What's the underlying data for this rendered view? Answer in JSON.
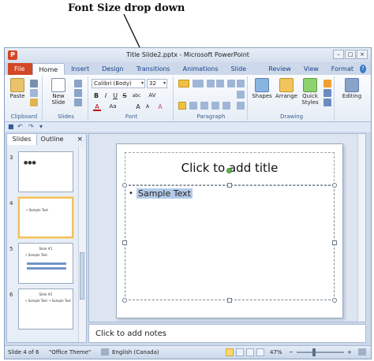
{
  "annotation": {
    "label": "Font Size drop down"
  },
  "window": {
    "title": "Title Slide2.pptx - Microsoft PowerPoint",
    "app_icon": "P",
    "controls": [
      "–",
      "□",
      "×"
    ]
  },
  "tabs": [
    "File",
    "Home",
    "Insert",
    "Design",
    "Transitions",
    "Animations",
    "Slide Show",
    "Review",
    "View",
    "Format"
  ],
  "help": "?",
  "ribbon": {
    "clipboard": {
      "paste": "Paste",
      "label": "Clipboard"
    },
    "slides": {
      "new_slide": "New Slide",
      "new_slide_line2": "Slide ▾",
      "label": "Slides"
    },
    "font": {
      "font_name": "Calibri (Body)",
      "font_size": "32",
      "label": "Font",
      "bold": "B",
      "italic": "I",
      "underline": "U",
      "strike": "S",
      "shadow": "abc",
      "spacing": "AV",
      "case": "Aa",
      "color": "A",
      "grow": "A",
      "shrink": "A",
      "clear": "A"
    },
    "paragraph": {
      "label": "Paragraph"
    },
    "drawing": {
      "shapes": "Shapes",
      "arrange": "Arrange",
      "quick_styles": "Quick Styles",
      "quick_styles_line2": "Styles ▾",
      "label": "Drawing"
    },
    "editing": {
      "label": "Editing"
    }
  },
  "panel": {
    "tabs": [
      "Slides",
      "Outline"
    ],
    "close": "×",
    "thumbnails": [
      {
        "num": "3",
        "title": "",
        "body": ""
      },
      {
        "num": "4",
        "title": "",
        "body": "• Sample Text"
      },
      {
        "num": "5",
        "title": "Slide #1",
        "body": "• Sample Text"
      },
      {
        "num": "6",
        "title": "Slide #2",
        "body": "• Sample Text"
      }
    ]
  },
  "slide": {
    "title_placeholder": "Click to add title",
    "bullet": "•",
    "body_text": "Sample Text"
  },
  "notes": {
    "placeholder": "Click to add notes"
  },
  "status": {
    "slide_info": "Slide 4 of 6",
    "theme": "\"Office Theme\"",
    "language": "English (Canada)",
    "zoom": "47%"
  }
}
